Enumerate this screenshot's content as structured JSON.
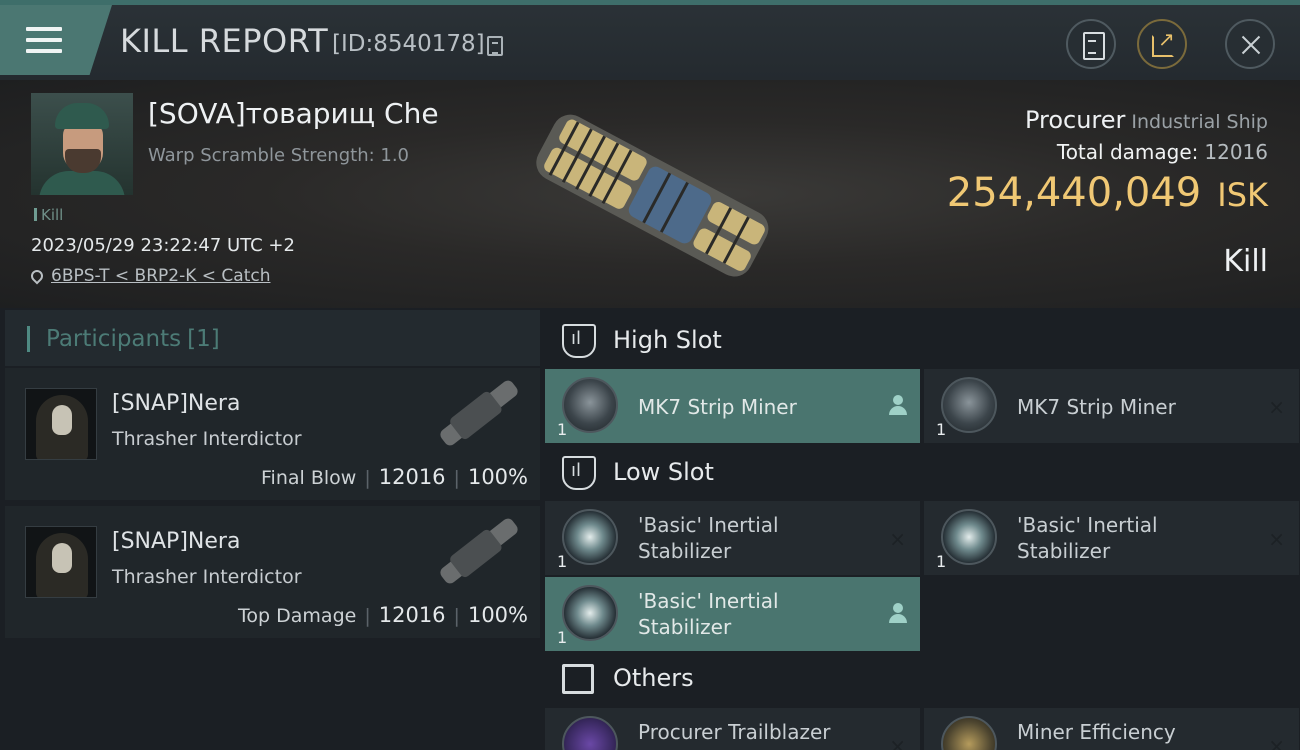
{
  "topbar": {
    "title": "KILL REPORT",
    "report_id": "[ID:8540178]"
  },
  "victim": {
    "name": "[SOVA]товарищ Che",
    "warp_scramble": "Warp Scramble Strength: 1.0",
    "tag": "Kill",
    "datetime": "2023/05/29 23:22:47 UTC +2",
    "location": "6BPS-T < BRP2-K < Catch"
  },
  "ship": {
    "name": "Procurer",
    "class": "Industrial Ship",
    "total_damage_label": "Total damage:",
    "total_damage_value": "12016",
    "isk_value": "254,440,049",
    "isk_unit": "ISK",
    "kill_type": "Kill"
  },
  "participants": {
    "label": "Participants",
    "count": "[1]",
    "items": [
      {
        "name": "[SNAP]Nera",
        "ship": "Thrasher Interdictor",
        "role": "Final Blow",
        "damage": "12016",
        "percent": "100%"
      },
      {
        "name": "[SNAP]Nera",
        "ship": "Thrasher Interdictor",
        "role": "Top Damage",
        "damage": "12016",
        "percent": "100%"
      }
    ]
  },
  "fitting": {
    "high_slot": {
      "label": "High Slot",
      "items": [
        {
          "name": "MK7 Strip Miner",
          "qty": "1",
          "state": "dropped"
        },
        {
          "name": "MK7 Strip Miner",
          "qty": "1",
          "state": "destroyed"
        }
      ]
    },
    "low_slot": {
      "label": "Low Slot",
      "items": [
        {
          "name_line1": "'Basic' Inertial",
          "name_line2": "Stabilizer",
          "qty": "1",
          "state": "destroyed"
        },
        {
          "name_line1": "'Basic' Inertial",
          "name_line2": "Stabilizer",
          "qty": "1",
          "state": "destroyed"
        },
        {
          "name_line1": "'Basic' Inertial",
          "name_line2": "Stabilizer",
          "qty": "1",
          "state": "dropped"
        }
      ]
    },
    "others": {
      "label": "Others",
      "items": [
        {
          "name": "Procurer Trailblazer",
          "state": "destroyed"
        },
        {
          "name": "Miner Efficiency",
          "state": "destroyed"
        }
      ]
    }
  },
  "icons": {
    "destroyed": "×",
    "colors": {
      "accent": "#4b7772",
      "isk": "#f0c874",
      "dropped_bg": "#4a756f"
    }
  }
}
